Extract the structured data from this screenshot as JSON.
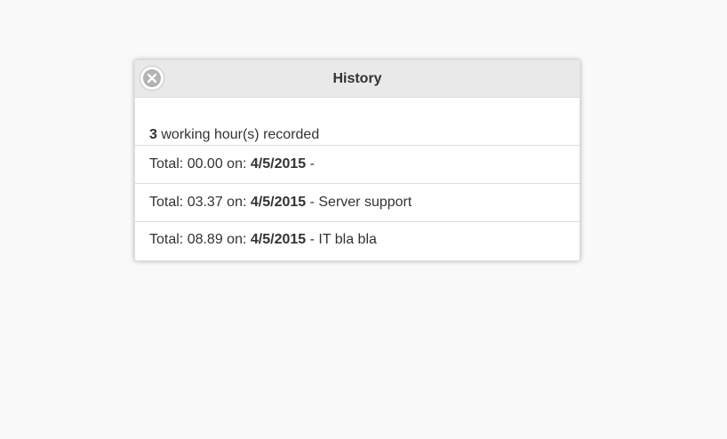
{
  "dialog": {
    "title": "History",
    "close_icon": "close-circle-icon"
  },
  "summary": {
    "count": "3",
    "text": "working hour(s) recorded"
  },
  "entries": [
    {
      "prefix": "Total: ",
      "total": "00.00",
      "on": " on: ",
      "date": "4/5/2015",
      "sep": " - ",
      "description": ""
    },
    {
      "prefix": "Total: ",
      "total": "03.37",
      "on": " on: ",
      "date": "4/5/2015",
      "sep": " - ",
      "description": "Server support"
    },
    {
      "prefix": "Total: ",
      "total": "08.89",
      "on": " on: ",
      "date": "4/5/2015",
      "sep": " - ",
      "description": "IT bla bla"
    }
  ]
}
